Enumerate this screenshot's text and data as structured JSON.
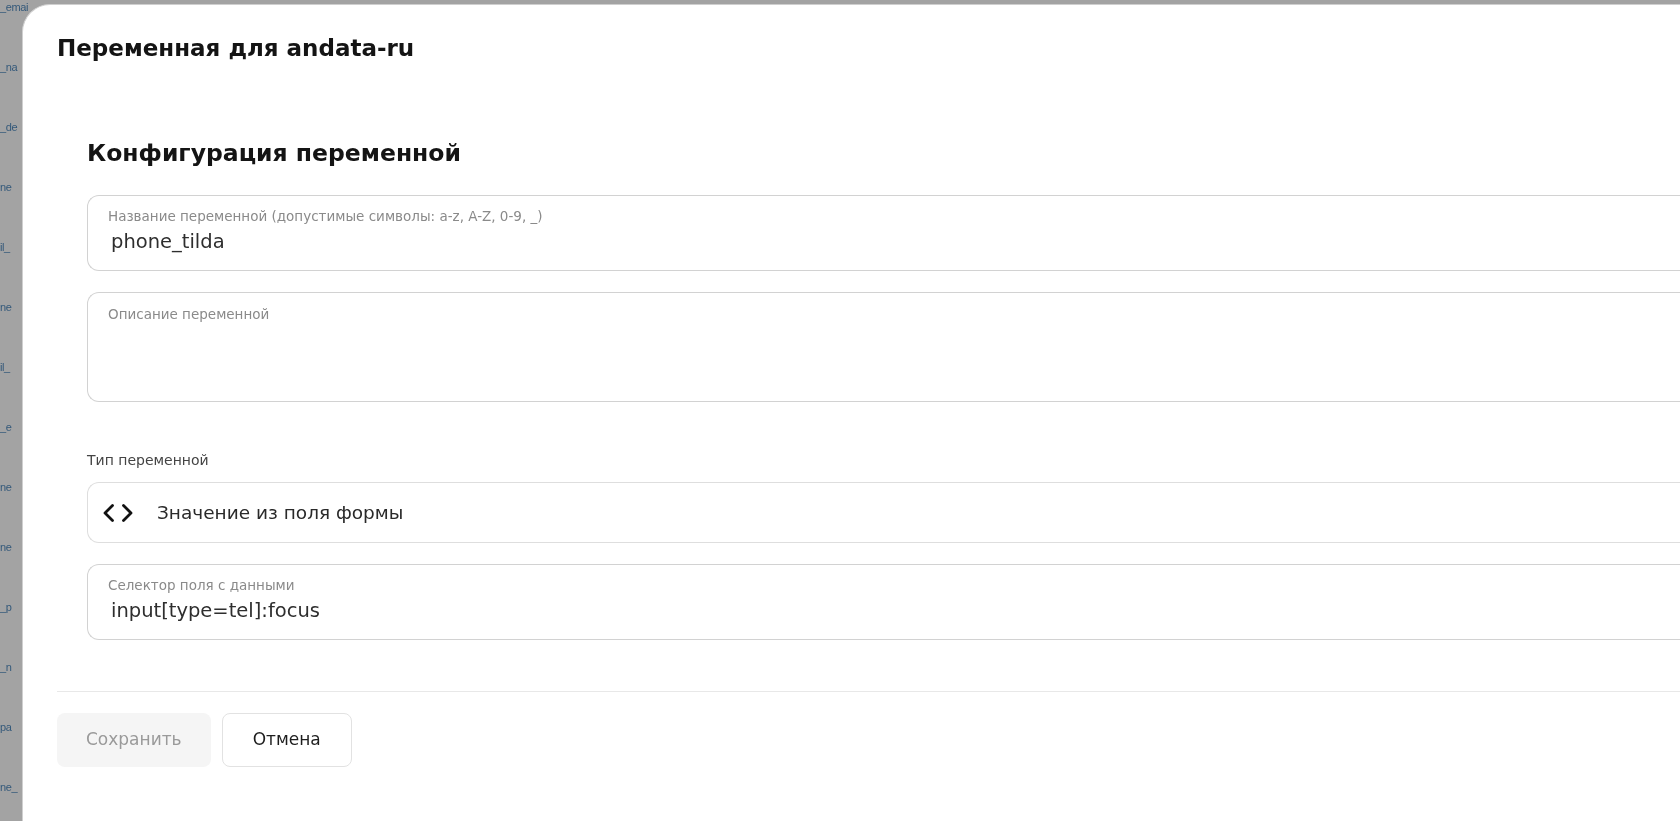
{
  "background_list": {
    "items": [
      "_emai",
      "_na",
      "_de",
      "ne",
      "il_",
      "ne",
      "il_",
      "_e",
      "ne",
      "ne",
      "_p",
      "_n",
      "pa",
      "ne_"
    ]
  },
  "dialog": {
    "title": "Переменная для andata-ru",
    "section_title": "Конфигурация переменной",
    "fields": [
      {
        "kind": "text",
        "label": "Название переменной (допустимые символы: a-z, A-Z, 0-9, _)",
        "value": "phone_tilda"
      },
      {
        "kind": "textarea",
        "label": "Описание переменной"
      },
      {
        "kind": "select",
        "caption": "Тип переменной",
        "value": "Значение из поля формы"
      },
      {
        "kind": "text",
        "label": "Селектор поля с данными",
        "value": "input[type=tel]:focus"
      }
    ],
    "buttons": [
      {
        "label": "Сохранить",
        "disabled": true
      },
      {
        "label": "Отмена",
        "disabled": false
      }
    ]
  }
}
